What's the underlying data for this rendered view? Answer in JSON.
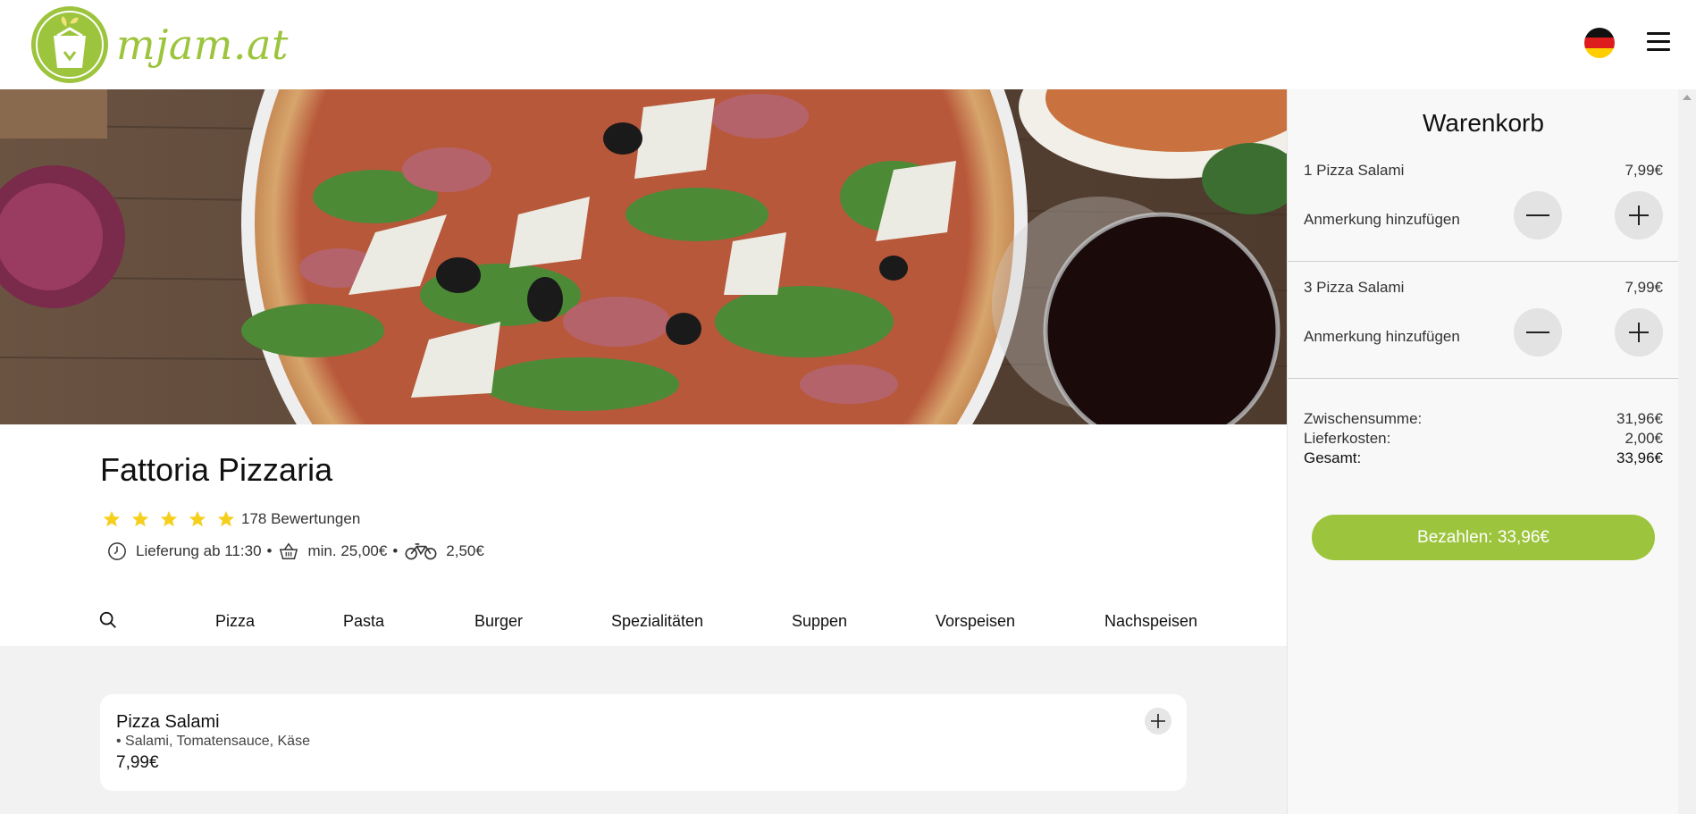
{
  "brand": {
    "name": "mjam.at",
    "color": "#9cc43c"
  },
  "header": {
    "language_flag": "germany-flag-icon",
    "menu_icon": "hamburger-menu-icon"
  },
  "restaurant": {
    "name": "Fattoria Pizzaria",
    "rating_stars": 5,
    "reviews": "178 Bewertungen",
    "delivery_time": "Lieferung ab 11:30",
    "min_order": "min. 25,00€",
    "delivery_fee": "2,50€",
    "separator": "•"
  },
  "categories": [
    "Pizza",
    "Pasta",
    "Burger",
    "Spezialitäten",
    "Suppen",
    "Vorspeisen",
    "Nachspeisen"
  ],
  "menu": {
    "items": [
      {
        "name": "Pizza Salami",
        "description": "• Salami, Tomatensauce, Käse",
        "price": "7,99€"
      }
    ]
  },
  "cart": {
    "title": "Warenkorb",
    "items": [
      {
        "name": "1 Pizza Salami",
        "price": "7,99€",
        "note_label": "Anmerkung hinzufügen"
      },
      {
        "name": "3 Pizza Salami",
        "price": "7,99€",
        "note_label": "Anmerkung hinzufügen"
      }
    ],
    "subtotal_label": "Zwischensumme:",
    "subtotal": "31,96€",
    "delivery_label": "Lieferkosten:",
    "delivery": "2,00€",
    "total_label": "Gesamt:",
    "total": "33,96€",
    "pay_button": "Bezahlen: 33,96€"
  }
}
